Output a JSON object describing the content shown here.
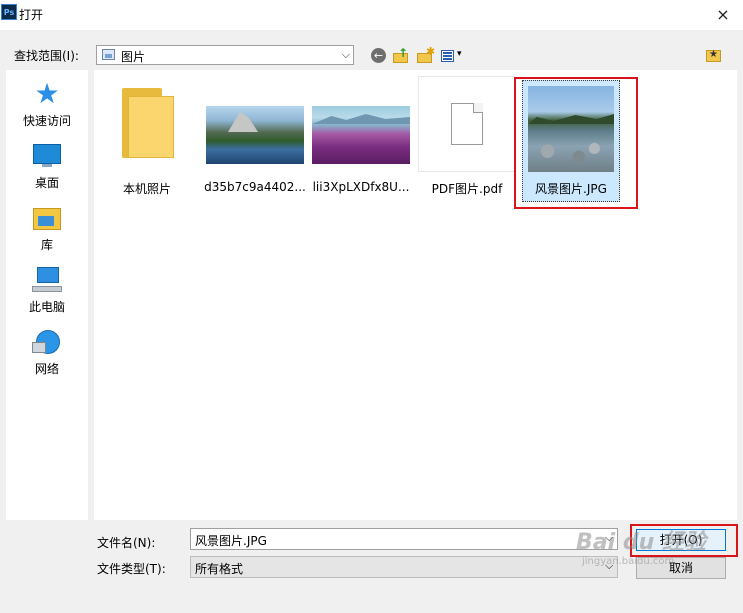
{
  "window": {
    "app_icon_text": "Ps",
    "title": "打开",
    "close_glyph": "×"
  },
  "lookin": {
    "label": "查找范围(I):",
    "value": "图片",
    "dropdown_glyph": "⌵"
  },
  "toolbar": {
    "back_glyph": "←",
    "view_glyph": "▾"
  },
  "sidebar": {
    "items": [
      {
        "label": "快速访问",
        "icon": "star-icon"
      },
      {
        "label": "桌面",
        "icon": "desktop-icon"
      },
      {
        "label": "库",
        "icon": "library-icon"
      },
      {
        "label": "此电脑",
        "icon": "computer-icon"
      },
      {
        "label": "网络",
        "icon": "network-icon"
      }
    ]
  },
  "files": [
    {
      "name": "本机照片",
      "kind": "folder"
    },
    {
      "name": "d35b7c9a4402...",
      "kind": "image"
    },
    {
      "name": "lii3XpLXDfx8U...",
      "kind": "image"
    },
    {
      "name": "PDF图片.pdf",
      "kind": "document"
    },
    {
      "name": "风景图片.JPG",
      "kind": "image",
      "selected": true
    }
  ],
  "filename": {
    "label": "文件名(N):",
    "value": "风景图片.JPG",
    "dropdown_glyph": "⌵"
  },
  "filetype": {
    "label": "文件类型(T):",
    "value": "所有格式",
    "dropdown_glyph": "⌵"
  },
  "buttons": {
    "open": "打开(O)",
    "cancel": "取消"
  },
  "watermark": {
    "logo": "Bai du 经验",
    "sub": "jingyan.baidu.com"
  },
  "colors": {
    "highlight_red": "#d9141a",
    "selection_blue": "#cce8ff",
    "accent_blue": "#0078d7"
  }
}
